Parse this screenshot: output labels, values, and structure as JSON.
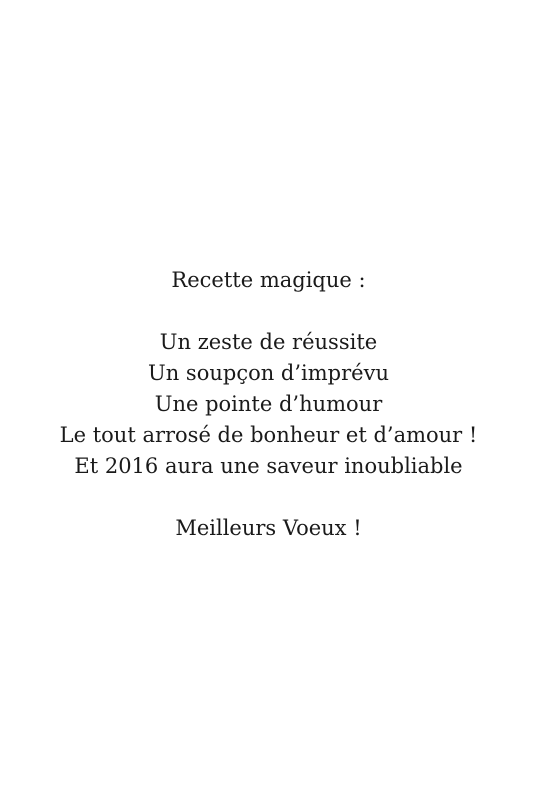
{
  "card": {
    "heading": "Recette magique :",
    "lines": [
      "Un zeste de réussite",
      "Un soupçon d’imprévu",
      "Une pointe d’humour",
      "Le tout arrosé de bonheur et d’amour !",
      "Et 2016 aura une saveur inoubliable"
    ],
    "closing": "Meilleurs Voeux !"
  }
}
